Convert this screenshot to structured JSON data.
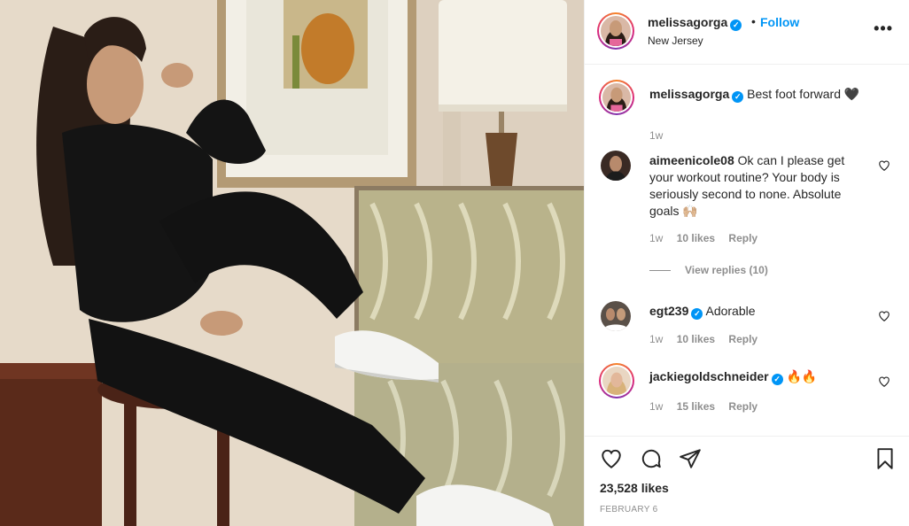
{
  "post": {
    "author": "melissagorga",
    "follow_label": "Follow",
    "separator": "•",
    "location": "New Jersey",
    "more_label": "•••",
    "likes": "23,528 likes",
    "date": "FEBRUARY 6"
  },
  "caption": {
    "username": "melissagorga",
    "text": "Best foot forward 🖤",
    "time": "1w"
  },
  "comments": [
    {
      "username": "aimeenicole08",
      "text": "Ok can I please get your workout routine? Your body is seriously second to none. Absolute goals 🙌🏼",
      "time": "1w",
      "likes": "10 likes",
      "reply": "Reply",
      "view_replies": "View replies (10)"
    },
    {
      "username": "egt239",
      "text": "Adorable",
      "time": "1w",
      "likes": "10 likes",
      "reply": "Reply"
    },
    {
      "username": "jackiegoldschneider",
      "text": "🔥🔥",
      "time": "1w",
      "likes": "15 likes",
      "reply": "Reply"
    }
  ],
  "icons": {
    "verified": "verified-badge-icon",
    "heart": "heart-outline-icon",
    "comment": "comment-bubble-icon",
    "share": "paper-plane-icon",
    "save": "bookmark-icon"
  },
  "colors": {
    "accent": "#0095f6",
    "text": "#262626",
    "muted": "#8e8e8e",
    "divider": "#efefef"
  }
}
